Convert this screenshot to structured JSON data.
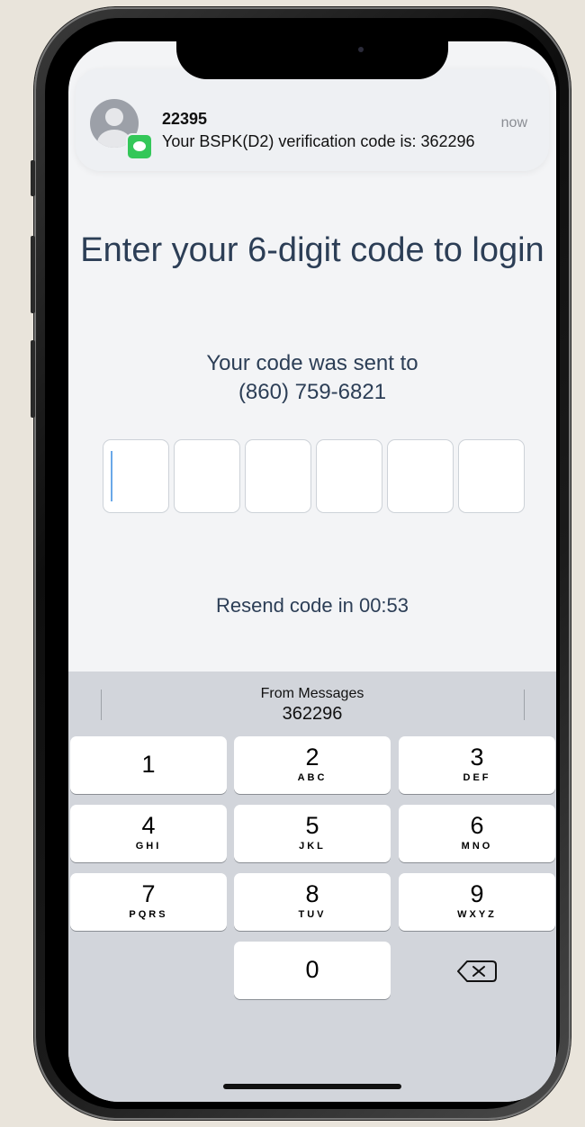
{
  "notification": {
    "sender": "22395",
    "body": "Your BSPK(D2) verification code is: 362296",
    "time": "now",
    "app_icon": "messages-icon"
  },
  "page": {
    "title": "Enter your 6-digit code to login",
    "subtitle_line1": "Your code was sent to",
    "subtitle_line2": "(860) 759-6821",
    "code_length": 6,
    "resend_text": "Resend code in 00:53"
  },
  "keyboard": {
    "suggestion_label": "From Messages",
    "suggestion_code": "362296",
    "keys": [
      {
        "num": "1",
        "letters": ""
      },
      {
        "num": "2",
        "letters": "ABC"
      },
      {
        "num": "3",
        "letters": "DEF"
      },
      {
        "num": "4",
        "letters": "GHI"
      },
      {
        "num": "5",
        "letters": "JKL"
      },
      {
        "num": "6",
        "letters": "MNO"
      },
      {
        "num": "7",
        "letters": "PQRS"
      },
      {
        "num": "8",
        "letters": "TUV"
      },
      {
        "num": "9",
        "letters": "WXYZ"
      },
      {
        "num": "0",
        "letters": ""
      }
    ],
    "delete_icon": "delete-backspace-icon"
  },
  "colors": {
    "text_primary": "#2c3e56",
    "keyboard_bg": "#d2d5db",
    "messages_green": "#34c759",
    "cursor_blue": "#6aa8e8"
  }
}
